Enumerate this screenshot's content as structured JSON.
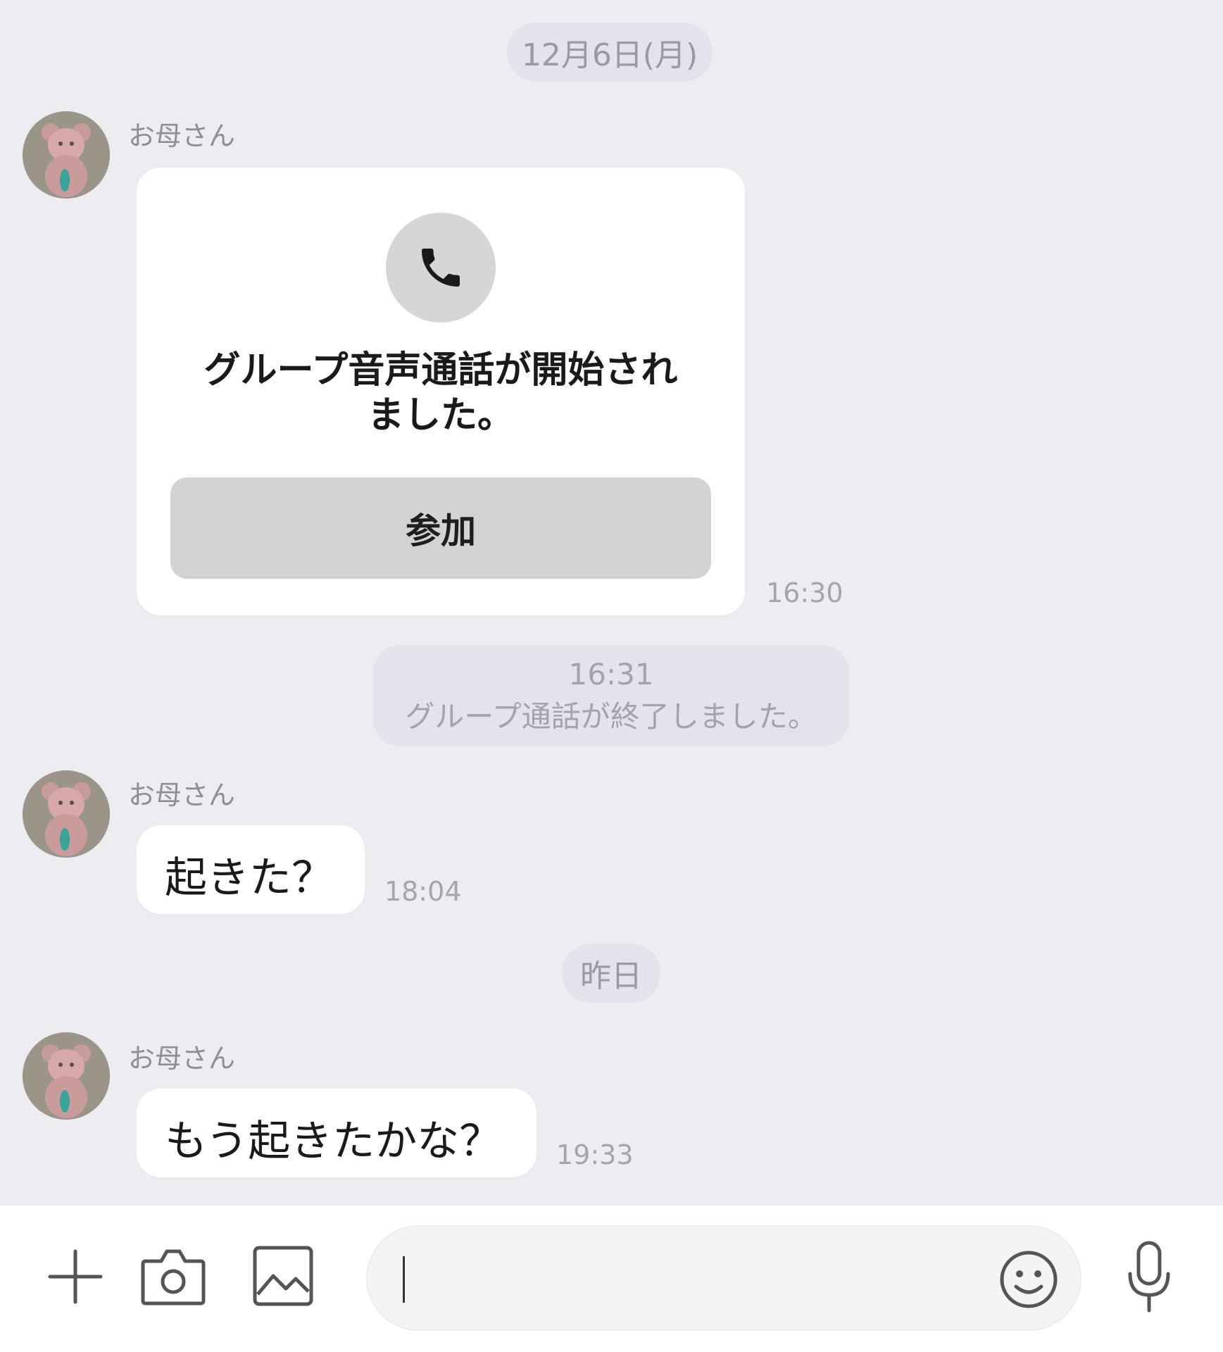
{
  "chat": {
    "date_header_1": "12月6日(月)",
    "date_header_2": "昨日",
    "messages": [
      {
        "sender": "お母さん",
        "type": "call_card",
        "call_title": "グループ音声通話が開始されました。",
        "call_title_line1": "グループ音声通話が開始され",
        "call_title_line2": "ました。",
        "join_label": "参加",
        "time": "16:30"
      },
      {
        "type": "system",
        "time": "16:31",
        "text": "グループ通話が終了しました。"
      },
      {
        "sender": "お母さん",
        "type": "text",
        "text": "起きた？",
        "time": "18:04"
      },
      {
        "sender": "お母さん",
        "type": "text",
        "text": "もう起きたかな？",
        "time": "19:33"
      }
    ]
  },
  "input_bar": {
    "plus_icon": "plus-icon",
    "camera_icon": "camera-icon",
    "image_icon": "image-icon",
    "emoji_icon": "emoji-icon",
    "mic_icon": "microphone-icon",
    "message_value": ""
  },
  "colors": {
    "background": "#ececf1",
    "bubble": "#ffffff",
    "pill": "#e3e3ec",
    "join_button": "#d3d3d5"
  }
}
